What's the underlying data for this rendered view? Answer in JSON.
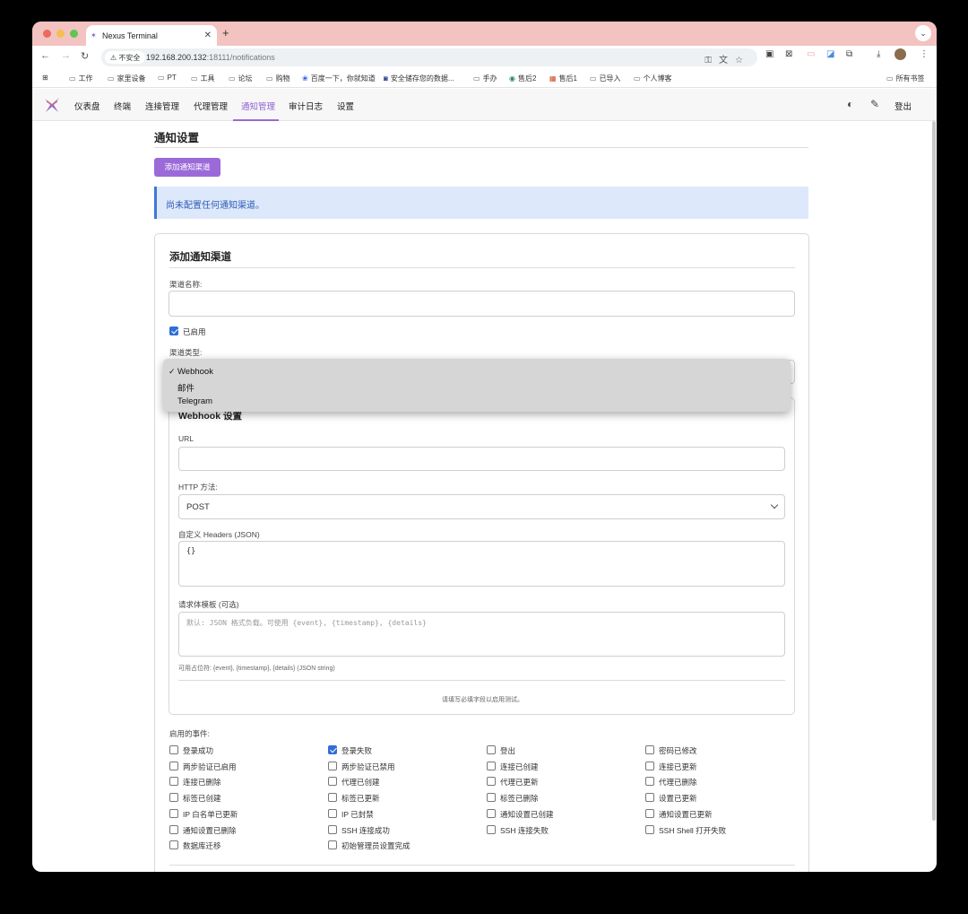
{
  "browser": {
    "tab_title": "Nexus Terminal",
    "security_label": "不安全",
    "url_host": "192.168.200.132",
    "url_path": ":18111/notifications",
    "bookmarks": [
      "工作",
      "家里设备",
      "PT",
      "工具",
      "论坛",
      "购物",
      "百度一下，你就知道",
      "安全储存您的数据...",
      "手办",
      "售后2",
      "售后1",
      "已导入",
      "个人博客"
    ],
    "all_bookmarks": "所有书签"
  },
  "nav": {
    "items": [
      "仪表盘",
      "终端",
      "连接管理",
      "代理管理",
      "通知管理",
      "审计日志",
      "设置"
    ],
    "active": "通知管理",
    "logout": "登出"
  },
  "page": {
    "title": "通知设置",
    "add_button": "添加通知渠道",
    "empty_alert": "尚未配置任何通知渠道。"
  },
  "form": {
    "title": "添加通知渠道",
    "channel_name_label": "渠道名称:",
    "channel_name_value": "",
    "enabled_label": "已启用",
    "enabled": true,
    "channel_type_label": "渠道类型:",
    "channel_type_options": [
      "Webhook",
      "邮件",
      "Telegram"
    ],
    "channel_type_selected": "Webhook",
    "webhook": {
      "title": "Webhook 设置",
      "url_label": "URL",
      "url_value": "",
      "method_label": "HTTP 方法:",
      "method_value": "POST",
      "headers_label": "自定义 Headers (JSON)",
      "headers_value": "{}",
      "body_label": "请求体模板 (可选)",
      "body_placeholder": "默认: JSON 格式负载。可使用 {event}, {timestamp}, {details}",
      "placeholder_hint": "可用占位符: {event}, {timestamp}, {details} (JSON string)",
      "test_hint": "请填写必填字段以启用测试。"
    },
    "events_label": "启用的事件:",
    "events": [
      {
        "label": "登录成功",
        "checked": false
      },
      {
        "label": "登录失败",
        "checked": true
      },
      {
        "label": "登出",
        "checked": false
      },
      {
        "label": "密码已修改",
        "checked": false
      },
      {
        "label": "两步验证已启用",
        "checked": false
      },
      {
        "label": "两步验证已禁用",
        "checked": false
      },
      {
        "label": "连接已创建",
        "checked": false
      },
      {
        "label": "连接已更新",
        "checked": false
      },
      {
        "label": "连接已删除",
        "checked": false
      },
      {
        "label": "代理已创建",
        "checked": false
      },
      {
        "label": "代理已更新",
        "checked": false
      },
      {
        "label": "代理已删除",
        "checked": false
      },
      {
        "label": "标签已创建",
        "checked": false
      },
      {
        "label": "标签已更新",
        "checked": false
      },
      {
        "label": "标签已删除",
        "checked": false
      },
      {
        "label": "设置已更新",
        "checked": false
      },
      {
        "label": "IP 白名单已更新",
        "checked": false
      },
      {
        "label": "IP 已封禁",
        "checked": false
      },
      {
        "label": "通知设置已创建",
        "checked": false
      },
      {
        "label": "通知设置已更新",
        "checked": false
      },
      {
        "label": "通知设置已删除",
        "checked": false
      },
      {
        "label": "SSH 连接成功",
        "checked": false
      },
      {
        "label": "SSH 连接失败",
        "checked": false
      },
      {
        "label": "SSH Shell 打开失败",
        "checked": false
      },
      {
        "label": "数据库迁移",
        "checked": false
      },
      {
        "label": "初始管理员设置完成",
        "checked": false
      }
    ]
  },
  "colors": {
    "accent": "#9b6ad8",
    "info_bg": "#dde9fb",
    "info_text": "#2f5bb5",
    "checkbox": "#2f6fd6"
  }
}
